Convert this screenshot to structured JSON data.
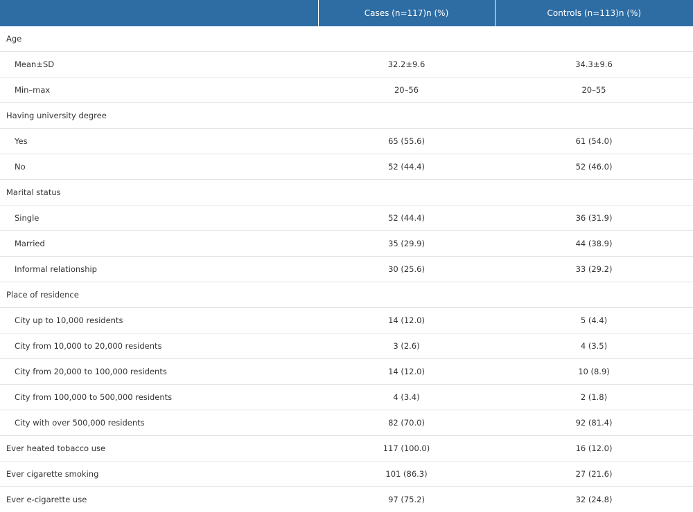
{
  "header": {
    "col1": "",
    "col2": "Cases (n=117)n (%)",
    "col3": "Controls (n=113)n (%)"
  },
  "rows": [
    {
      "label": "Age",
      "cases": "",
      "controls": ""
    },
    {
      "label": "Mean±SD",
      "cases": "32.2±9.6",
      "controls": "34.3±9.6"
    },
    {
      "label": "Min–max",
      "cases": "20–56",
      "controls": "20–55"
    },
    {
      "label": "Having university degree",
      "cases": "",
      "controls": ""
    },
    {
      "label": "Yes",
      "cases": "65 (55.6)",
      "controls": "61 (54.0)"
    },
    {
      "label": "No",
      "cases": "52 (44.4)",
      "controls": "52 (46.0)"
    },
    {
      "label": "Marital status",
      "cases": "",
      "controls": ""
    },
    {
      "label": "Single",
      "cases": "52 (44.4)",
      "controls": "36 (31.9)"
    },
    {
      "label": "Married",
      "cases": "35 (29.9)",
      "controls": "44 (38.9)"
    },
    {
      "label": "Informal relationship",
      "cases": "30 (25.6)",
      "controls": "33 (29.2)"
    },
    {
      "label": "Place of residence",
      "cases": "",
      "controls": ""
    },
    {
      "label": "City up to 10,000 residents",
      "cases": "14 (12.0)",
      "controls": "5 (4.4)"
    },
    {
      "label": "City from 10,000 to 20,000 residents",
      "cases": "3 (2.6)",
      "controls": "4 (3.5)"
    },
    {
      "label": "City from 20,000 to 100,000 residents",
      "cases": "14 (12.0)",
      "controls": "10 (8.9)"
    },
    {
      "label": "City from 100,000 to 500,000 residents",
      "cases": "4 (3.4)",
      "controls": "2 (1.8)"
    },
    {
      "label": "City with over 500,000 residents",
      "cases": "82 (70.0)",
      "controls": "92 (81.4)"
    },
    {
      "label": "Ever heated tobacco use",
      "cases": "117 (100.0)",
      "controls": "16 (12.0)"
    },
    {
      "label": "Ever cigarette smoking",
      "cases": "101 (86.3)",
      "controls": "27 (21.6)"
    },
    {
      "label": "Ever e-cigarette use",
      "cases": "97 (75.2)",
      "controls": "32 (24.8)"
    }
  ]
}
